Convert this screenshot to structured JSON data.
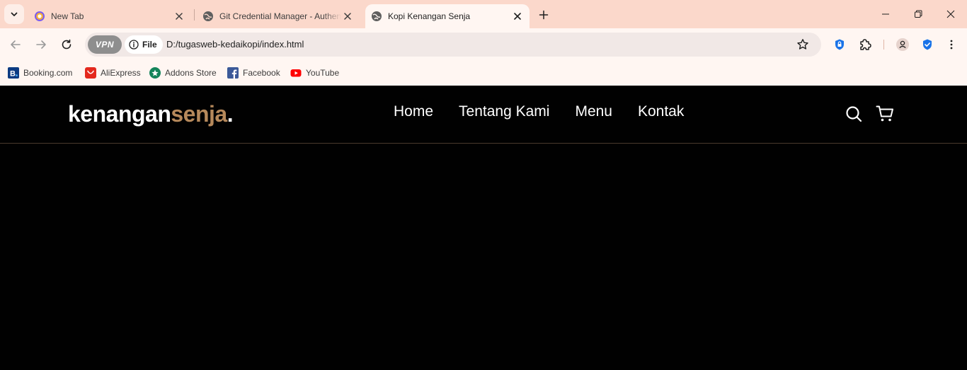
{
  "browser": {
    "tabs": [
      {
        "title": "New Tab",
        "icon": "new-tab-icon",
        "active": false
      },
      {
        "title": "Git Credential Manager - Authentication",
        "icon": "globe-icon",
        "active": false
      },
      {
        "title": "Kopi Kenangan Senja",
        "icon": "globe-icon",
        "active": true
      }
    ],
    "vpn_label": "VPN",
    "file_label": "File",
    "url": "D:/tugasweb-kedaikopi/index.html",
    "bookmarks": [
      {
        "label": "Booking.com",
        "icon": "booking-icon"
      },
      {
        "label": "AliExpress",
        "icon": "aliexpress-icon"
      },
      {
        "label": "Addons Store",
        "icon": "addons-store-icon"
      },
      {
        "label": "Facebook",
        "icon": "facebook-icon"
      },
      {
        "label": "YouTube",
        "icon": "youtube-icon"
      }
    ],
    "colors": {
      "tabstrip": "#fbd8cb",
      "toolbar": "#fff6f2"
    }
  },
  "site": {
    "logo_main": "kenangan",
    "logo_accent": "senja",
    "logo_dot": ".",
    "nav": [
      "Home",
      "Tentang Kami",
      "Menu",
      "Kontak"
    ],
    "icons": [
      "search-icon",
      "shopping-cart-icon"
    ],
    "colors": {
      "background": "#010101",
      "accent": "#b6895b",
      "text": "#ffffff",
      "divider": "#4a3a2c"
    }
  }
}
